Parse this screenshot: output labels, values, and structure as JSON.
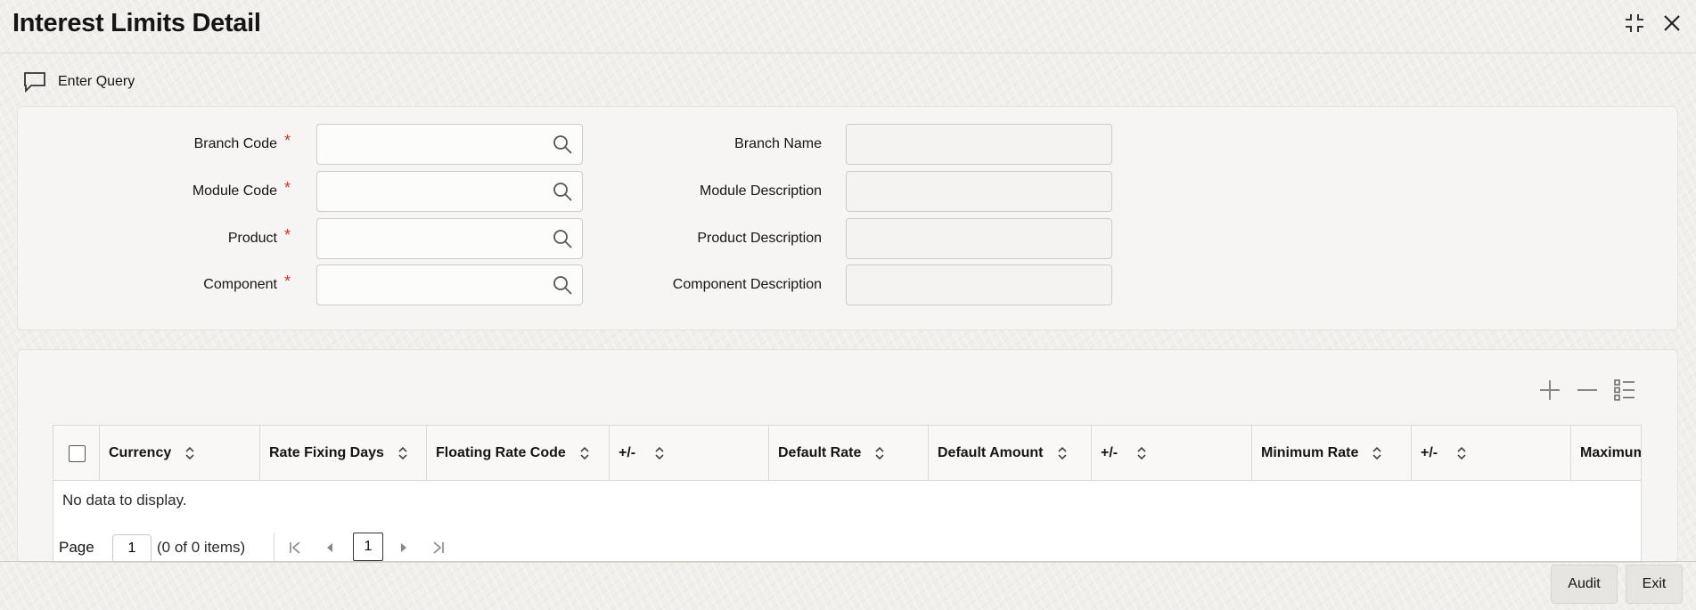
{
  "window": {
    "title": "Interest Limits Detail",
    "maximize_icon": "collapse-icon",
    "close_icon": "close-icon"
  },
  "toolbar": {
    "enter_query_label": "Enter Query",
    "enter_query_icon": "chat-bubble-icon"
  },
  "form": {
    "left_fields": [
      {
        "label": "Branch Code",
        "required": "*",
        "value": ""
      },
      {
        "label": "Module Code",
        "required": "*",
        "value": ""
      },
      {
        "label": "Product",
        "required": "*",
        "value": ""
      },
      {
        "label": "Component",
        "required": "*",
        "value": ""
      }
    ],
    "right_fields": [
      {
        "label": "Branch Name",
        "value": ""
      },
      {
        "label": "Module Description",
        "value": ""
      },
      {
        "label": "Product Description",
        "value": ""
      },
      {
        "label": "Component Description",
        "value": ""
      }
    ]
  },
  "grid": {
    "actions": [
      "add-icon",
      "remove-icon",
      "list-view-icon"
    ],
    "columns": [
      "Currency",
      "Rate Fixing Days",
      "Floating Rate Code",
      "+/-",
      "Default Rate",
      "Default Amount",
      "+/-",
      "Minimum Rate",
      "+/-",
      "Maximum"
    ],
    "empty_message": "No data to display.",
    "pager": {
      "page_label": "Page",
      "page_value": "1",
      "items_info": "(0 of 0 items)",
      "current_page": "1"
    }
  },
  "footer": {
    "audit_label": "Audit",
    "exit_label": "Exit"
  },
  "colors": {
    "required": "#c0392b",
    "text": "#161513",
    "border": "#cfcbc5"
  }
}
